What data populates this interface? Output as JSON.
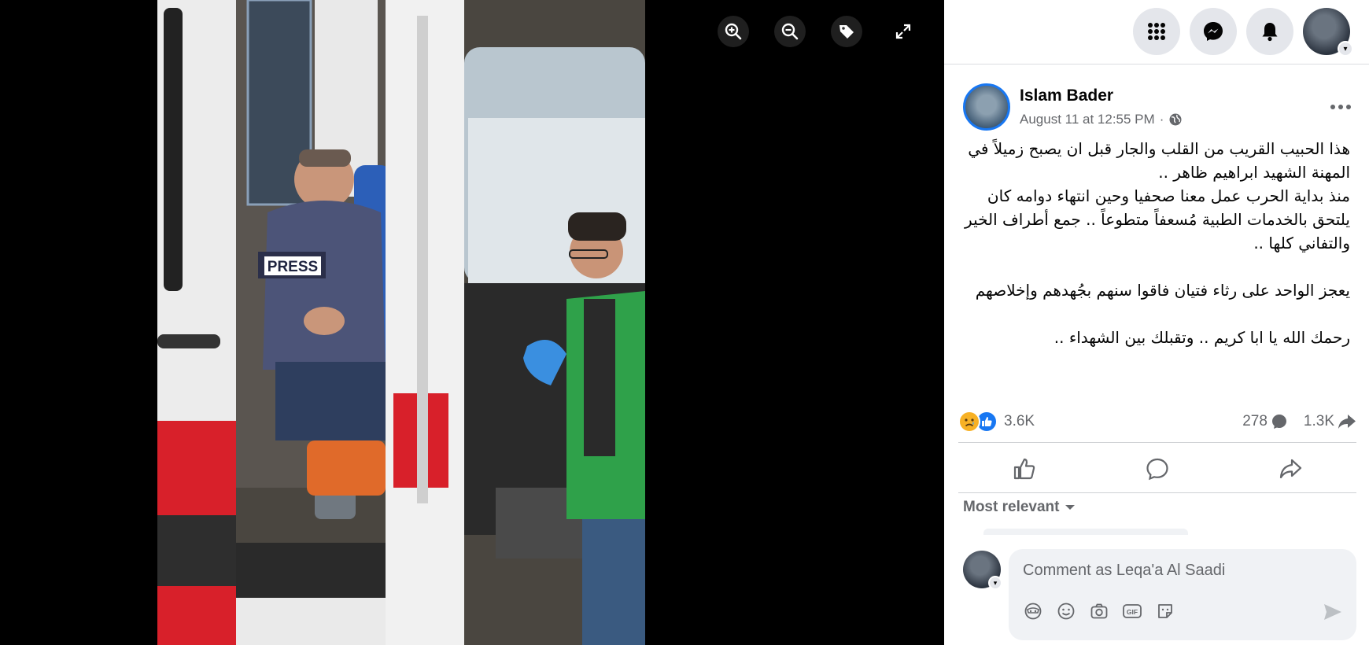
{
  "viewer": {
    "photo_desc_icon": "photo",
    "tools": [
      {
        "name": "zoom-in-icon"
      },
      {
        "name": "zoom-out-icon"
      },
      {
        "name": "tag-icon"
      },
      {
        "name": "fullscreen-icon"
      }
    ],
    "press_label": "PRESS"
  },
  "topbar": {
    "icons": [
      "menu-grid-icon",
      "messenger-icon",
      "notifications-icon",
      "account-avatar"
    ]
  },
  "post": {
    "author": "Islam Bader",
    "timestamp": "August 11 at 12:55 PM",
    "separator": "·",
    "privacy_icon": "globe-icon",
    "paragraph1": "هذا الحبيب القريب من القلب والجار قبل ان يصبح زميلاً في المهنة الشهيد ابراهيم ظاهر ..\nمنذ بداية الحرب عمل معنا صحفيا وحين انتهاء دوامه كان يلتحق بالخدمات الطبية مُسعفاً متطوعاً .. جمع أطراف الخير والتفاني كلها ..",
    "paragraph2": "يعجز الواحد على رثاء فتيان فاقوا سنهم بجُهدهم وإخلاصهم",
    "paragraph3": "رحمك الله يا ابا كريم .. وتقبلك بين الشهداء .."
  },
  "stats": {
    "reactions": "3.6K",
    "comments": "278",
    "shares": "1.3K"
  },
  "comments": {
    "sort_label": "Most relevant",
    "placeholder": "Comment as Leqa'a Al Saadi"
  },
  "colors": {
    "accent": "#1877f2",
    "muted": "#65676b",
    "sad": "#f7b125"
  }
}
